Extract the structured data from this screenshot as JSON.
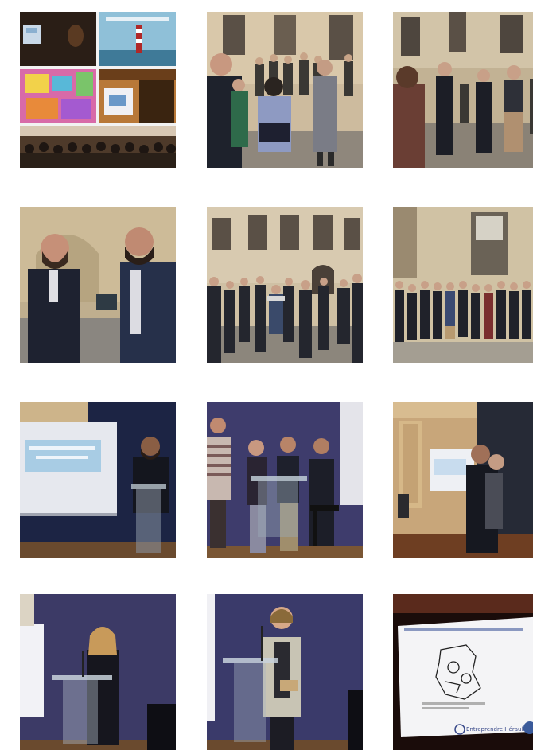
{
  "gallery": {
    "photos": [
      {
        "name": "photo-collage-presentation"
      },
      {
        "name": "photo-courtyard-crowd-talking"
      },
      {
        "name": "photo-courtyard-group-standing"
      },
      {
        "name": "photo-two-men-talking"
      },
      {
        "name": "photo-courtyard-crowd-wide"
      },
      {
        "name": "photo-group-portrait-courtyard"
      },
      {
        "name": "photo-speaker-at-screen"
      },
      {
        "name": "photo-four-presenters-podium"
      },
      {
        "name": "photo-speakers-near-projector"
      },
      {
        "name": "photo-woman-speaking-podium"
      },
      {
        "name": "photo-woman-reading-podium"
      },
      {
        "name": "photo-slide-map-screen"
      }
    ]
  },
  "slides": {
    "logo_text": "Entreprendre Hérault"
  }
}
